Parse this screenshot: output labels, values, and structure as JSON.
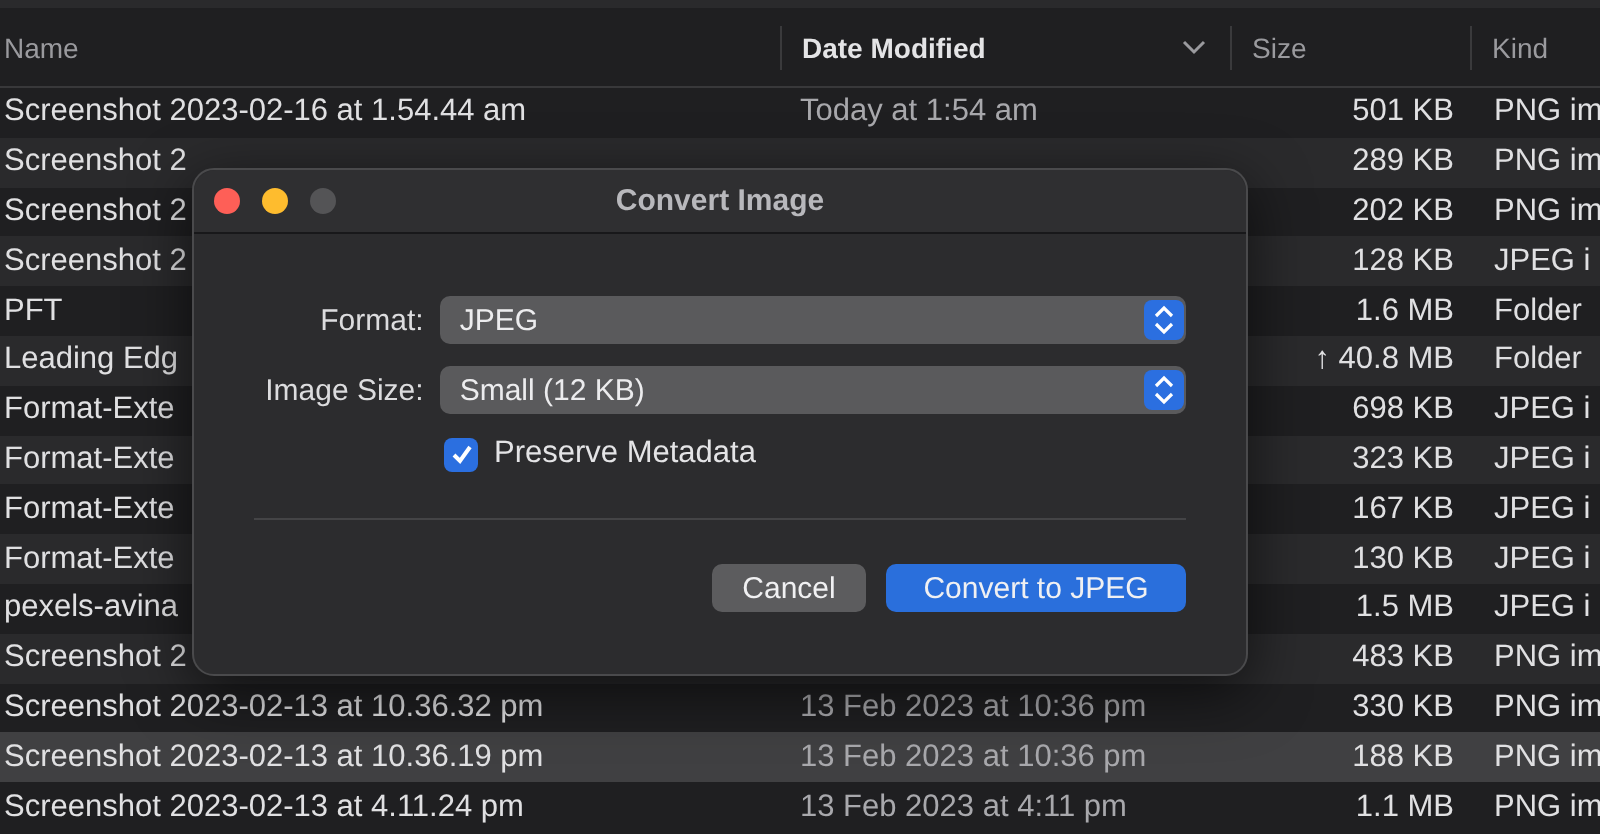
{
  "table": {
    "columns": [
      {
        "label": "Name",
        "sorted": false
      },
      {
        "label": "Date Modified",
        "sorted": true
      },
      {
        "label": "Size",
        "sorted": false
      },
      {
        "label": "Kind",
        "sorted": false
      }
    ],
    "rows": [
      {
        "name": "Screenshot 2023-02-16 at 1.54.44 am",
        "date": "Today at 1:54 am",
        "size": "501 KB",
        "kind": "PNG im",
        "selected": false
      },
      {
        "name": "Screenshot 2",
        "size": "289 KB",
        "kind": "PNG im",
        "selected": false
      },
      {
        "name": "Screenshot 2",
        "size": "202 KB",
        "kind": "PNG im",
        "selected": false
      },
      {
        "name": "Screenshot 2",
        "size": "128 KB",
        "kind": "JPEG i",
        "selected": false
      },
      {
        "name": "PFT",
        "size": "1.6 MB",
        "kind": "Folder",
        "selected": false
      },
      {
        "name": "Leading Edg",
        "size": "↑ 40.8 MB",
        "kind": "Folder",
        "selected": false
      },
      {
        "name": "Format-Exte",
        "size": "698 KB",
        "kind": "JPEG i",
        "selected": false
      },
      {
        "name": "Format-Exte",
        "size": "323 KB",
        "kind": "JPEG i",
        "selected": false
      },
      {
        "name": "Format-Exte",
        "size": "167 KB",
        "kind": "JPEG i",
        "selected": false
      },
      {
        "name": "Format-Exte",
        "size": "130 KB",
        "kind": "JPEG i",
        "selected": false
      },
      {
        "name": "pexels-avina",
        "size": "1.5 MB",
        "kind": "JPEG i",
        "selected": false
      },
      {
        "name": "Screenshot 2",
        "size": "483 KB",
        "kind": "PNG im",
        "selected": false
      },
      {
        "name": "Screenshot 2023-02-13 at 10.36.32 pm",
        "date": "13 Feb 2023 at 10:36 pm",
        "size": "330 KB",
        "kind": "PNG im",
        "selected": false
      },
      {
        "name": "Screenshot 2023-02-13 at 10.36.19 pm",
        "date": "13 Feb 2023 at 10:36 pm",
        "size": "188 KB",
        "kind": "PNG im",
        "selected": true
      },
      {
        "name": "Screenshot 2023-02-13 at 4.11.24 pm",
        "date": "13 Feb 2023 at 4:11 pm",
        "size": "1.1 MB",
        "kind": "PNG im",
        "selected": false
      }
    ]
  },
  "dialog": {
    "title": "Convert Image",
    "zoom_disabled": true,
    "fields": [
      {
        "label": "Format:",
        "value": "JPEG"
      },
      {
        "label": "Image Size:",
        "value": "Small (12 KB)"
      }
    ],
    "checkbox": {
      "label": "Preserve Metadata",
      "checked": true
    },
    "buttons": [
      {
        "label": "Cancel",
        "kind": "secondary"
      },
      {
        "label": "Convert to JPEG",
        "kind": "primary"
      }
    ]
  }
}
